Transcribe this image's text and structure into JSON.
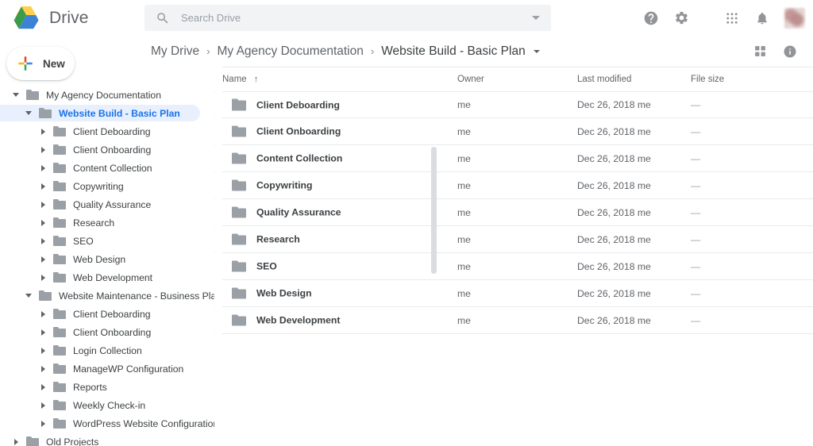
{
  "app": {
    "name": "Drive",
    "logo_icon": "drive-logo"
  },
  "search": {
    "placeholder": "Search Drive",
    "value": "",
    "icon": "search-icon",
    "caret_icon": "chevron-down-icon"
  },
  "topbar": {
    "help_icon": "help-icon",
    "settings_icon": "gear-icon",
    "apps_icon": "apps-grid-icon",
    "notifications_icon": "bell-icon",
    "avatar_icon": "avatar"
  },
  "new_button": {
    "label": "New",
    "icon": "plus-icon"
  },
  "breadcrumb": {
    "items": [
      {
        "label": "My Drive"
      },
      {
        "label": "My Agency Documentation"
      },
      {
        "label": "Website Build - Basic Plan"
      }
    ],
    "separator": "›",
    "caret_icon": "chevron-down-icon"
  },
  "view_controls": {
    "grid_view_icon": "grid-view-icon",
    "details_icon": "info-icon"
  },
  "sidebar": {
    "items": [
      {
        "label": "My Agency Documentation",
        "depth": 0,
        "state": "expanded",
        "selected": false
      },
      {
        "label": "Website Build - Basic Plan",
        "depth": 1,
        "state": "expanded",
        "selected": true
      },
      {
        "label": "Client Deboarding",
        "depth": 2,
        "state": "collapsed",
        "selected": false
      },
      {
        "label": "Client Onboarding",
        "depth": 2,
        "state": "collapsed",
        "selected": false
      },
      {
        "label": "Content Collection",
        "depth": 2,
        "state": "collapsed",
        "selected": false
      },
      {
        "label": "Copywriting",
        "depth": 2,
        "state": "collapsed",
        "selected": false
      },
      {
        "label": "Quality Assurance",
        "depth": 2,
        "state": "collapsed",
        "selected": false
      },
      {
        "label": "Research",
        "depth": 2,
        "state": "collapsed",
        "selected": false
      },
      {
        "label": "SEO",
        "depth": 2,
        "state": "collapsed",
        "selected": false
      },
      {
        "label": "Web Design",
        "depth": 2,
        "state": "collapsed",
        "selected": false
      },
      {
        "label": "Web Development",
        "depth": 2,
        "state": "collapsed",
        "selected": false
      },
      {
        "label": "Website Maintenance - Business Plan",
        "depth": 1,
        "state": "expanded",
        "selected": false
      },
      {
        "label": "Client Deboarding",
        "depth": 2,
        "state": "collapsed",
        "selected": false
      },
      {
        "label": "Client Onboarding",
        "depth": 2,
        "state": "collapsed",
        "selected": false
      },
      {
        "label": "Login Collection",
        "depth": 2,
        "state": "collapsed",
        "selected": false
      },
      {
        "label": "ManageWP Configuration",
        "depth": 2,
        "state": "collapsed",
        "selected": false
      },
      {
        "label": "Reports",
        "depth": 2,
        "state": "collapsed",
        "selected": false
      },
      {
        "label": "Weekly Check-in",
        "depth": 2,
        "state": "collapsed",
        "selected": false
      },
      {
        "label": "WordPress Website Configuration",
        "depth": 2,
        "state": "collapsed",
        "selected": false
      },
      {
        "label": "Old Projects",
        "depth": 0,
        "state": "collapsed",
        "selected": false
      }
    ]
  },
  "file_table": {
    "columns": {
      "name": "Name",
      "owner": "Owner",
      "modified": "Last modified",
      "size": "File size"
    },
    "sort_indicator": "↑",
    "rows": [
      {
        "name": "Client Deboarding",
        "owner": "me",
        "modified": "Dec 26, 2018 me",
        "size": "—"
      },
      {
        "name": "Client Onboarding",
        "owner": "me",
        "modified": "Dec 26, 2018 me",
        "size": "—"
      },
      {
        "name": "Content Collection",
        "owner": "me",
        "modified": "Dec 26, 2018 me",
        "size": "—"
      },
      {
        "name": "Copywriting",
        "owner": "me",
        "modified": "Dec 26, 2018 me",
        "size": "—"
      },
      {
        "name": "Quality Assurance",
        "owner": "me",
        "modified": "Dec 26, 2018 me",
        "size": "—"
      },
      {
        "name": "Research",
        "owner": "me",
        "modified": "Dec 26, 2018 me",
        "size": "—"
      },
      {
        "name": "SEO",
        "owner": "me",
        "modified": "Dec 26, 2018 me",
        "size": "—"
      },
      {
        "name": "Web Design",
        "owner": "me",
        "modified": "Dec 26, 2018 me",
        "size": "—"
      },
      {
        "name": "Web Development",
        "owner": "me",
        "modified": "Dec 26, 2018 me",
        "size": "—"
      }
    ]
  },
  "colors": {
    "accent": "#1a73e8",
    "selected_row_bg": "#e8f0fe",
    "text_primary": "#3c4043",
    "text_secondary": "#5f6368",
    "folder_gray": "#9aa0a6",
    "divider": "#e8eaed",
    "search_bg": "#f1f3f4"
  }
}
